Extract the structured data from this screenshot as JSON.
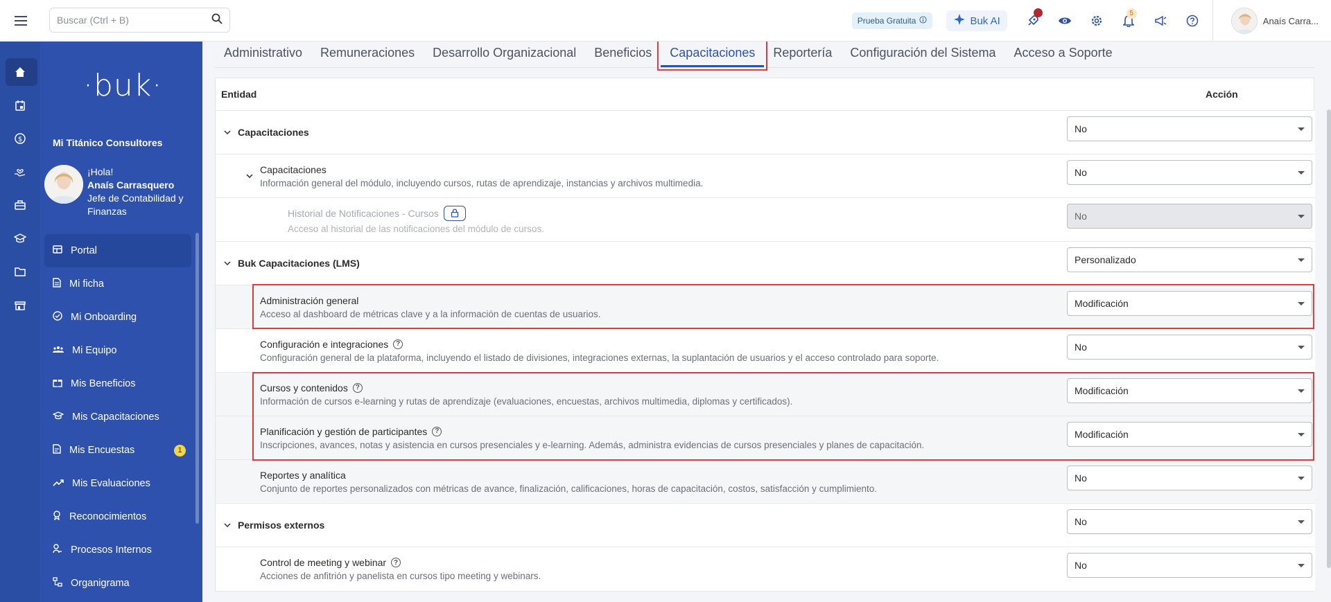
{
  "search": {
    "placeholder": "Buscar (Ctrl + B)"
  },
  "topbar": {
    "trial_label": "Prueba Gratuita",
    "ai_label": "Buk AI",
    "notifications_count": "5",
    "user_name": "Anaís Carra..."
  },
  "sidebar": {
    "logo": "·buk·",
    "org_name": "Mi Titánico Consultores",
    "greeting": "¡Hola!",
    "user_full_name": "Anaís Carrasquero",
    "user_role": "Jefe de Contabilidad y Finanzas",
    "items": [
      {
        "label": "Portal",
        "icon": "portal-icon"
      },
      {
        "label": "Mi ficha",
        "icon": "document-icon"
      },
      {
        "label": "Mi Onboarding",
        "icon": "check-circle-icon"
      },
      {
        "label": "Mi Equipo",
        "icon": "team-icon"
      },
      {
        "label": "Mis Beneficios",
        "icon": "gift-icon"
      },
      {
        "label": "Mis Capacitaciones",
        "icon": "graduation-icon"
      },
      {
        "label": "Mis Encuestas",
        "icon": "survey-icon",
        "badge": "1"
      },
      {
        "label": "Mis Evaluaciones",
        "icon": "trend-icon"
      },
      {
        "label": "Reconocimientos",
        "icon": "award-icon"
      },
      {
        "label": "Procesos Internos",
        "icon": "process-icon"
      },
      {
        "label": "Organigrama",
        "icon": "org-chart-icon"
      }
    ]
  },
  "tabs": [
    "Administrativo",
    "Remuneraciones",
    "Desarrollo Organizacional",
    "Beneficios",
    "Capacitaciones",
    "Reportería",
    "Configuración del Sistema",
    "Acceso a Soporte"
  ],
  "table": {
    "col_entity": "Entidad",
    "col_action": "Acción",
    "rows": [
      {
        "title": "Capacitaciones",
        "desc": "",
        "value": "No"
      },
      {
        "title": "Capacitaciones",
        "desc": "Información general del módulo, incluyendo cursos, rutas de aprendizaje, instancias y archivos multimedia.",
        "value": "No"
      },
      {
        "title": "Historial de Notificaciones - Cursos",
        "desc": "Acceso al historial de las notificaciones del módulo de cursos.",
        "value": "No"
      },
      {
        "title": "Buk Capacitaciones (LMS)",
        "desc": "",
        "value": "Personalizado"
      },
      {
        "title": "Administración general",
        "desc": "Acceso al dashboard de métricas clave y a la información de cuentas de usuarios.",
        "value": "Modificación"
      },
      {
        "title": "Configuración e integraciones",
        "desc": "Configuración general de la plataforma, incluyendo el listado de divisiones, integraciones externas, la suplantación de usuarios y el acceso controlado para soporte.",
        "value": "No"
      },
      {
        "title": "Cursos y contenidos",
        "desc": "Información de cursos e-learning y rutas de aprendizaje (evaluaciones, encuestas, archivos multimedia, diplomas y certificados).",
        "value": "Modificación"
      },
      {
        "title": "Planificación y gestión de participantes",
        "desc": "Inscripciones, avances, notas y asistencia en cursos presenciales y e-learning. Además, administra evidencias de cursos presenciales y planes de capacitación.",
        "value": "Modificación"
      },
      {
        "title": "Reportes y analítica",
        "desc": "Conjunto de reportes personalizados con métricas de avance, finalización, calificaciones, horas de capacitación, costos, satisfacción y cumplimiento.",
        "value": "No"
      },
      {
        "title": "Permisos externos",
        "desc": "",
        "value": "No"
      },
      {
        "title": "Control de meeting y webinar",
        "desc": "Acciones de anfitrión y panelista en cursos tipo meeting y webinars.",
        "value": "No"
      }
    ]
  },
  "colors": {
    "primary": "#2d51ac",
    "highlight": "#e03a3a"
  }
}
